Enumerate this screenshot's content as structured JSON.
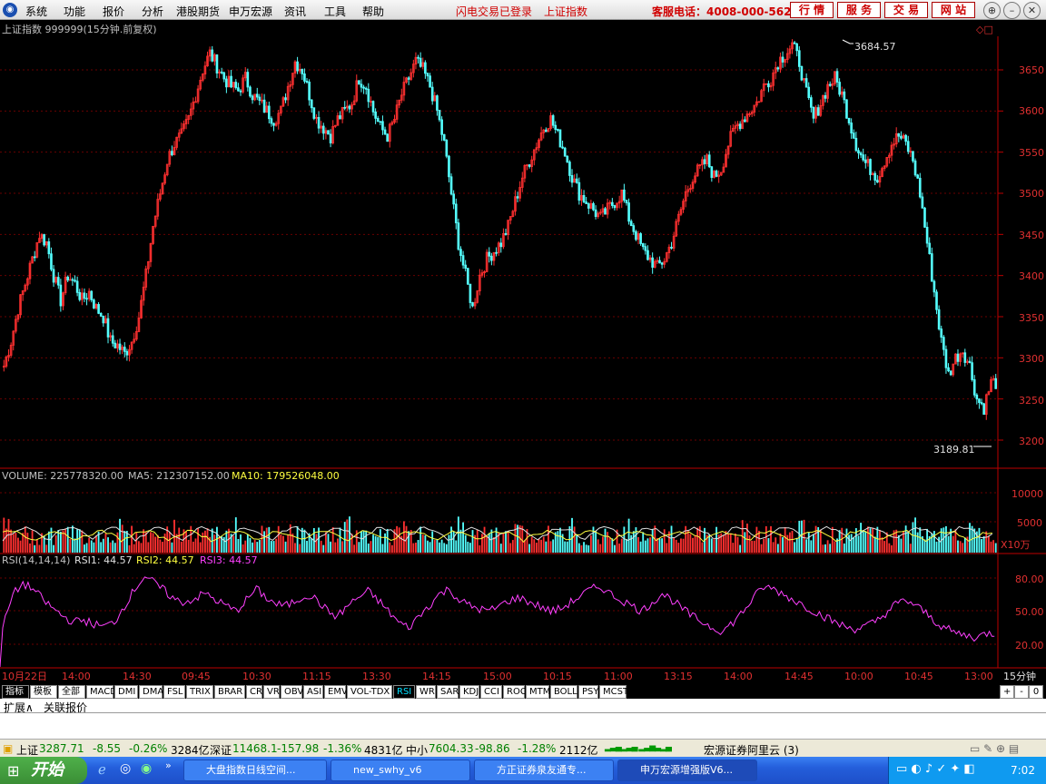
{
  "menu": {
    "items": [
      "系统",
      "功能",
      "报价",
      "分析",
      "港股期货",
      "申万宏源",
      "资讯",
      "工具",
      "帮助"
    ],
    "login_status": "闪电交易已登录",
    "index_link": "上证指数",
    "hotline": "客服电话：4008-000-562",
    "buttons": [
      "行 情",
      "服 务",
      "交 易",
      "网 站"
    ]
  },
  "chart_header": {
    "title": "上证指数 999999(15分钟.前复权)",
    "high_label": "3684.57",
    "low_label": "3189.81"
  },
  "price_axis": {
    "ticks": [
      "3650",
      "3600",
      "3550",
      "3500",
      "3450",
      "3400",
      "3350",
      "3300",
      "3250",
      "3200"
    ]
  },
  "volume": {
    "label": "VOLUME: 225778320.00",
    "ma5": "MA5: 212307152.00",
    "ma10": "MA10: 179526048.00",
    "ticks": [
      "10000",
      "5000"
    ],
    "unit": "X10万"
  },
  "rsi": {
    "label": "RSI(14,14,14)",
    "rsi1": "RSI1: 44.57",
    "rsi2": "RSI2: 44.57",
    "rsi3": "RSI3: 44.57",
    "ticks": [
      "80.00",
      "50.00",
      "20.00"
    ]
  },
  "time_axis": {
    "labels": [
      "10月22日",
      "14:00",
      "14:30",
      "09:45",
      "10:30",
      "11:15",
      "13:30",
      "14:15",
      "15:00",
      "10:15",
      "11:00",
      "13:15",
      "14:00",
      "14:45",
      "10:00",
      "10:45",
      "13:00"
    ],
    "period": "15分钟"
  },
  "indicator_tabs": [
    "指标",
    "模板",
    "全部",
    "MACD",
    "DMI",
    "DMA",
    "FSL",
    "TRIX",
    "BRAR",
    "CR",
    "VR",
    "OBV",
    "ASI",
    "EMV",
    "VOL-TDX",
    "RSI",
    "WR",
    "SAR",
    "KDJ",
    "CCI",
    "ROC",
    "MTM",
    "BOLL",
    "PSY",
    "MCST"
  ],
  "active_tab": "RSI",
  "tab_right": [
    "+",
    "-",
    "0"
  ],
  "ext_row": [
    "扩展∧",
    "关联报价"
  ],
  "status": {
    "sh_name": "上证",
    "sh_price": "3287.71",
    "sh_chg": "-8.55",
    "sh_pct": "-0.26%",
    "sh_amt": "3284亿",
    "sz_name": "深证",
    "sz_price": "11468.1",
    "sz_chg": "-157.98",
    "sz_pct": "-1.36%",
    "sz_amt": "4831亿",
    "zx_name": "中小",
    "zx_price": "7604.33",
    "zx_chg": "-98.86",
    "zx_pct": "-1.28%",
    "zx_amt": "2112亿",
    "server": "宏源证券阿里云 (3)"
  },
  "taskbar": {
    "start": "开始",
    "tasks": [
      "大盘指数日线空间...",
      "new_swhy_v6",
      "方正证券泉友通专...",
      "申万宏源增强版V6..."
    ],
    "clock": "7:02"
  },
  "chart_data": {
    "type": "candlestick",
    "title": "上证指数 999999(15分钟.前复权)",
    "period": "15分钟",
    "price_range": [
      3170,
      3700
    ],
    "high": 3684.57,
    "low": 3189.81,
    "close_path": [
      3290,
      3320,
      3360,
      3390,
      3420,
      3450,
      3440,
      3400,
      3370,
      3400,
      3390,
      3370,
      3380,
      3360,
      3350,
      3320,
      3315,
      3305,
      3320,
      3350,
      3400,
      3460,
      3500,
      3540,
      3560,
      3570,
      3590,
      3620,
      3650,
      3670,
      3655,
      3640,
      3630,
      3625,
      3640,
      3620,
      3610,
      3600,
      3590,
      3600,
      3630,
      3660,
      3650,
      3620,
      3590,
      3580,
      3570,
      3590,
      3600,
      3610,
      3640,
      3630,
      3600,
      3580,
      3570,
      3590,
      3620,
      3640,
      3660,
      3650,
      3630,
      3600,
      3560,
      3500,
      3440,
      3400,
      3360,
      3400,
      3420,
      3430,
      3440,
      3460,
      3490,
      3520,
      3540,
      3560,
      3580,
      3590,
      3570,
      3550,
      3520,
      3500,
      3490,
      3480,
      3470,
      3480,
      3490,
      3500,
      3470,
      3450,
      3430,
      3420,
      3410,
      3420,
      3440,
      3470,
      3500,
      3520,
      3530,
      3540,
      3520,
      3530,
      3560,
      3580,
      3590,
      3600,
      3610,
      3630,
      3640,
      3660,
      3670,
      3680,
      3660,
      3620,
      3590,
      3610,
      3630,
      3640,
      3620,
      3590,
      3560,
      3540,
      3530,
      3520,
      3540,
      3560,
      3570,
      3560,
      3540,
      3500,
      3440,
      3380,
      3320,
      3280,
      3300,
      3310,
      3290,
      3250,
      3240,
      3270
    ],
    "volume_ticks": [
      5000,
      10000
    ],
    "rsi_path": [
      35,
      65,
      75,
      70,
      60,
      52,
      45,
      40,
      42,
      38,
      36,
      40,
      55,
      70,
      82,
      75,
      68,
      60,
      58,
      62,
      66,
      60,
      55,
      50,
      60,
      70,
      62,
      56,
      55,
      60,
      65,
      60,
      50,
      45,
      55,
      62,
      68,
      60,
      50,
      40,
      35,
      45,
      55,
      65,
      70,
      60,
      55,
      52,
      50,
      55,
      60,
      62,
      58,
      54,
      50,
      52,
      58,
      64,
      70,
      72,
      65,
      60,
      55,
      50,
      58,
      66,
      60,
      52,
      45,
      40,
      35,
      32,
      40,
      50,
      62,
      72,
      70,
      65,
      60,
      55,
      50,
      45,
      40,
      36,
      34,
      36,
      40,
      48,
      56,
      60,
      55,
      48,
      40,
      34,
      30,
      28,
      26,
      30
    ]
  }
}
